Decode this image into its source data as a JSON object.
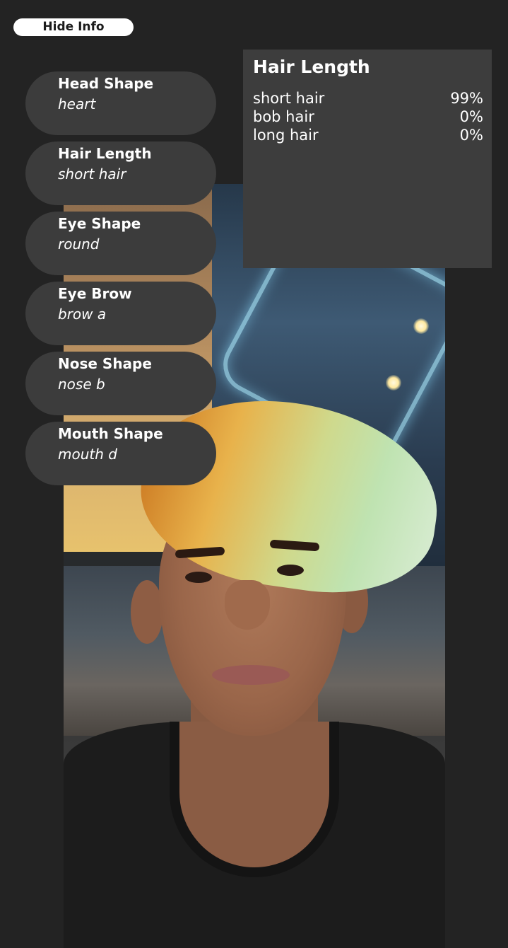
{
  "toggle": {
    "label": "Hide Info"
  },
  "features": [
    {
      "label": "Head Shape",
      "value": "heart"
    },
    {
      "label": "Hair Length",
      "value": "short hair"
    },
    {
      "label": "Eye Shape",
      "value": "round"
    },
    {
      "label": "Eye Brow",
      "value": "brow a"
    },
    {
      "label": "Nose Shape",
      "value": "nose b"
    },
    {
      "label": "Mouth Shape",
      "value": "mouth d"
    }
  ],
  "detail_panel": {
    "title": "Hair Length",
    "rows": [
      {
        "name": "short hair",
        "percent": "99%"
      },
      {
        "name": "bob hair",
        "percent": "0%"
      },
      {
        "name": "long hair",
        "percent": "0%"
      }
    ]
  },
  "colors": {
    "background": "#232323",
    "pill": "#3c3c3c",
    "panel": "#3d3d3d",
    "text": "#ffffff",
    "toggle_bg": "#ffffff"
  }
}
